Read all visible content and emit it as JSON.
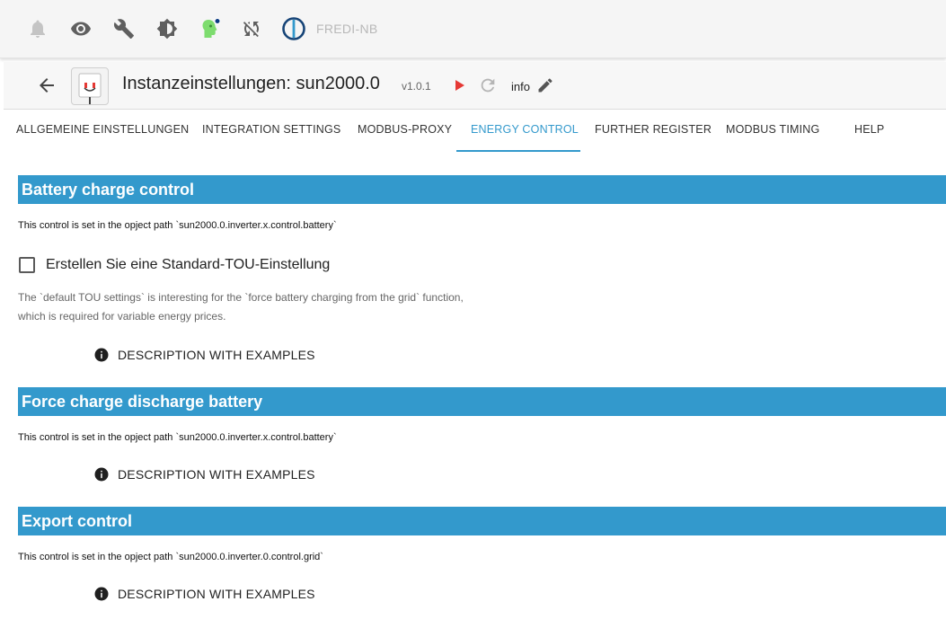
{
  "topbar": {
    "host": "FREDI-NB",
    "icons": [
      "bell-icon",
      "eye-icon",
      "wrench-icon",
      "brightness-icon",
      "robot-head-icon",
      "sync-icon",
      "iobroker-logo-icon"
    ]
  },
  "instance": {
    "title": "Instanzeinstellungen: sun2000.0",
    "version": "v1.0.1",
    "info": "info"
  },
  "tabs": [
    {
      "label": "ALLGEMEINE EINSTELLUNGEN"
    },
    {
      "label": "INTEGRATION SETTINGS"
    },
    {
      "label": "MODBUS-PROXY"
    },
    {
      "label": "ENERGY CONTROL"
    },
    {
      "label": "FURTHER REGISTER"
    },
    {
      "label": "MODBUS TIMING"
    },
    {
      "label": "HELP"
    }
  ],
  "active_tab": "ENERGY CONTROL",
  "sections": {
    "battery": {
      "title": "Battery charge control",
      "path": "This control is set in the opject path `sun2000.0.inverter.x.control.battery`",
      "checkbox_label": "Erstellen Sie eine Standard-TOU-Einstellung",
      "checkbox_checked": false,
      "helper_line1": "The `default TOU settings` is interesting for the `force battery charging from the grid` function,",
      "helper_line2": "which is required for variable energy prices.",
      "desc_button": "DESCRIPTION WITH EXAMPLES"
    },
    "force": {
      "title": "Force charge discharge battery",
      "path": "This control is set in the opject path `sun2000.0.inverter.x.control.battery`",
      "desc_button": "DESCRIPTION WITH EXAMPLES"
    },
    "export": {
      "title": "Export control",
      "path": "This control is set in the opject path `sun2000.0.inverter.0.control.grid`",
      "desc_button": "DESCRIPTION WITH EXAMPLES"
    }
  },
  "colors": {
    "accent": "#3399cc",
    "play": "#e53935",
    "robot": "#7ddc6e",
    "badge": "#0d3b82"
  }
}
